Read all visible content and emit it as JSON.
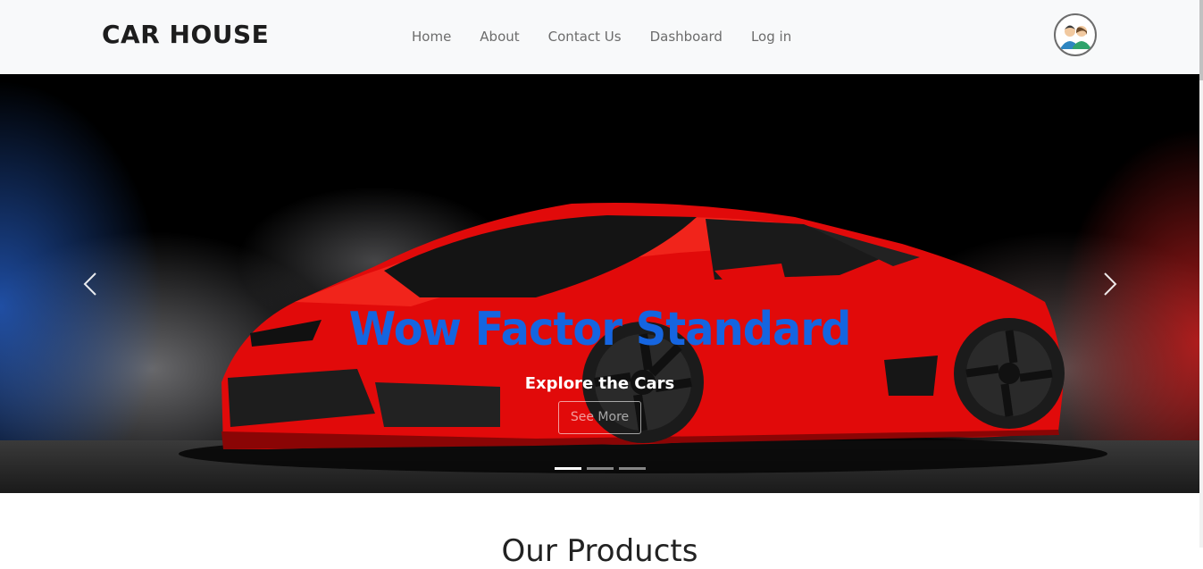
{
  "navbar": {
    "brand": "CAR HOUSE",
    "links": [
      "Home",
      "About",
      "Contact Us",
      "Dashboard",
      "Log in"
    ],
    "avatar_icon": "users-avatar-icon"
  },
  "carousel": {
    "title": "Wow Factor Standard",
    "subtitle": "Explore the Cars",
    "button_label": "See More",
    "prev_icon": "chevron-left-icon",
    "next_icon": "chevron-right-icon",
    "slide_count": 3,
    "active_slide": 1
  },
  "section": {
    "heading": "Our Products"
  },
  "colors": {
    "title_blue": "#1565e0",
    "car_red": "#e10a0a",
    "navbar_bg": "#f8f9fa"
  }
}
